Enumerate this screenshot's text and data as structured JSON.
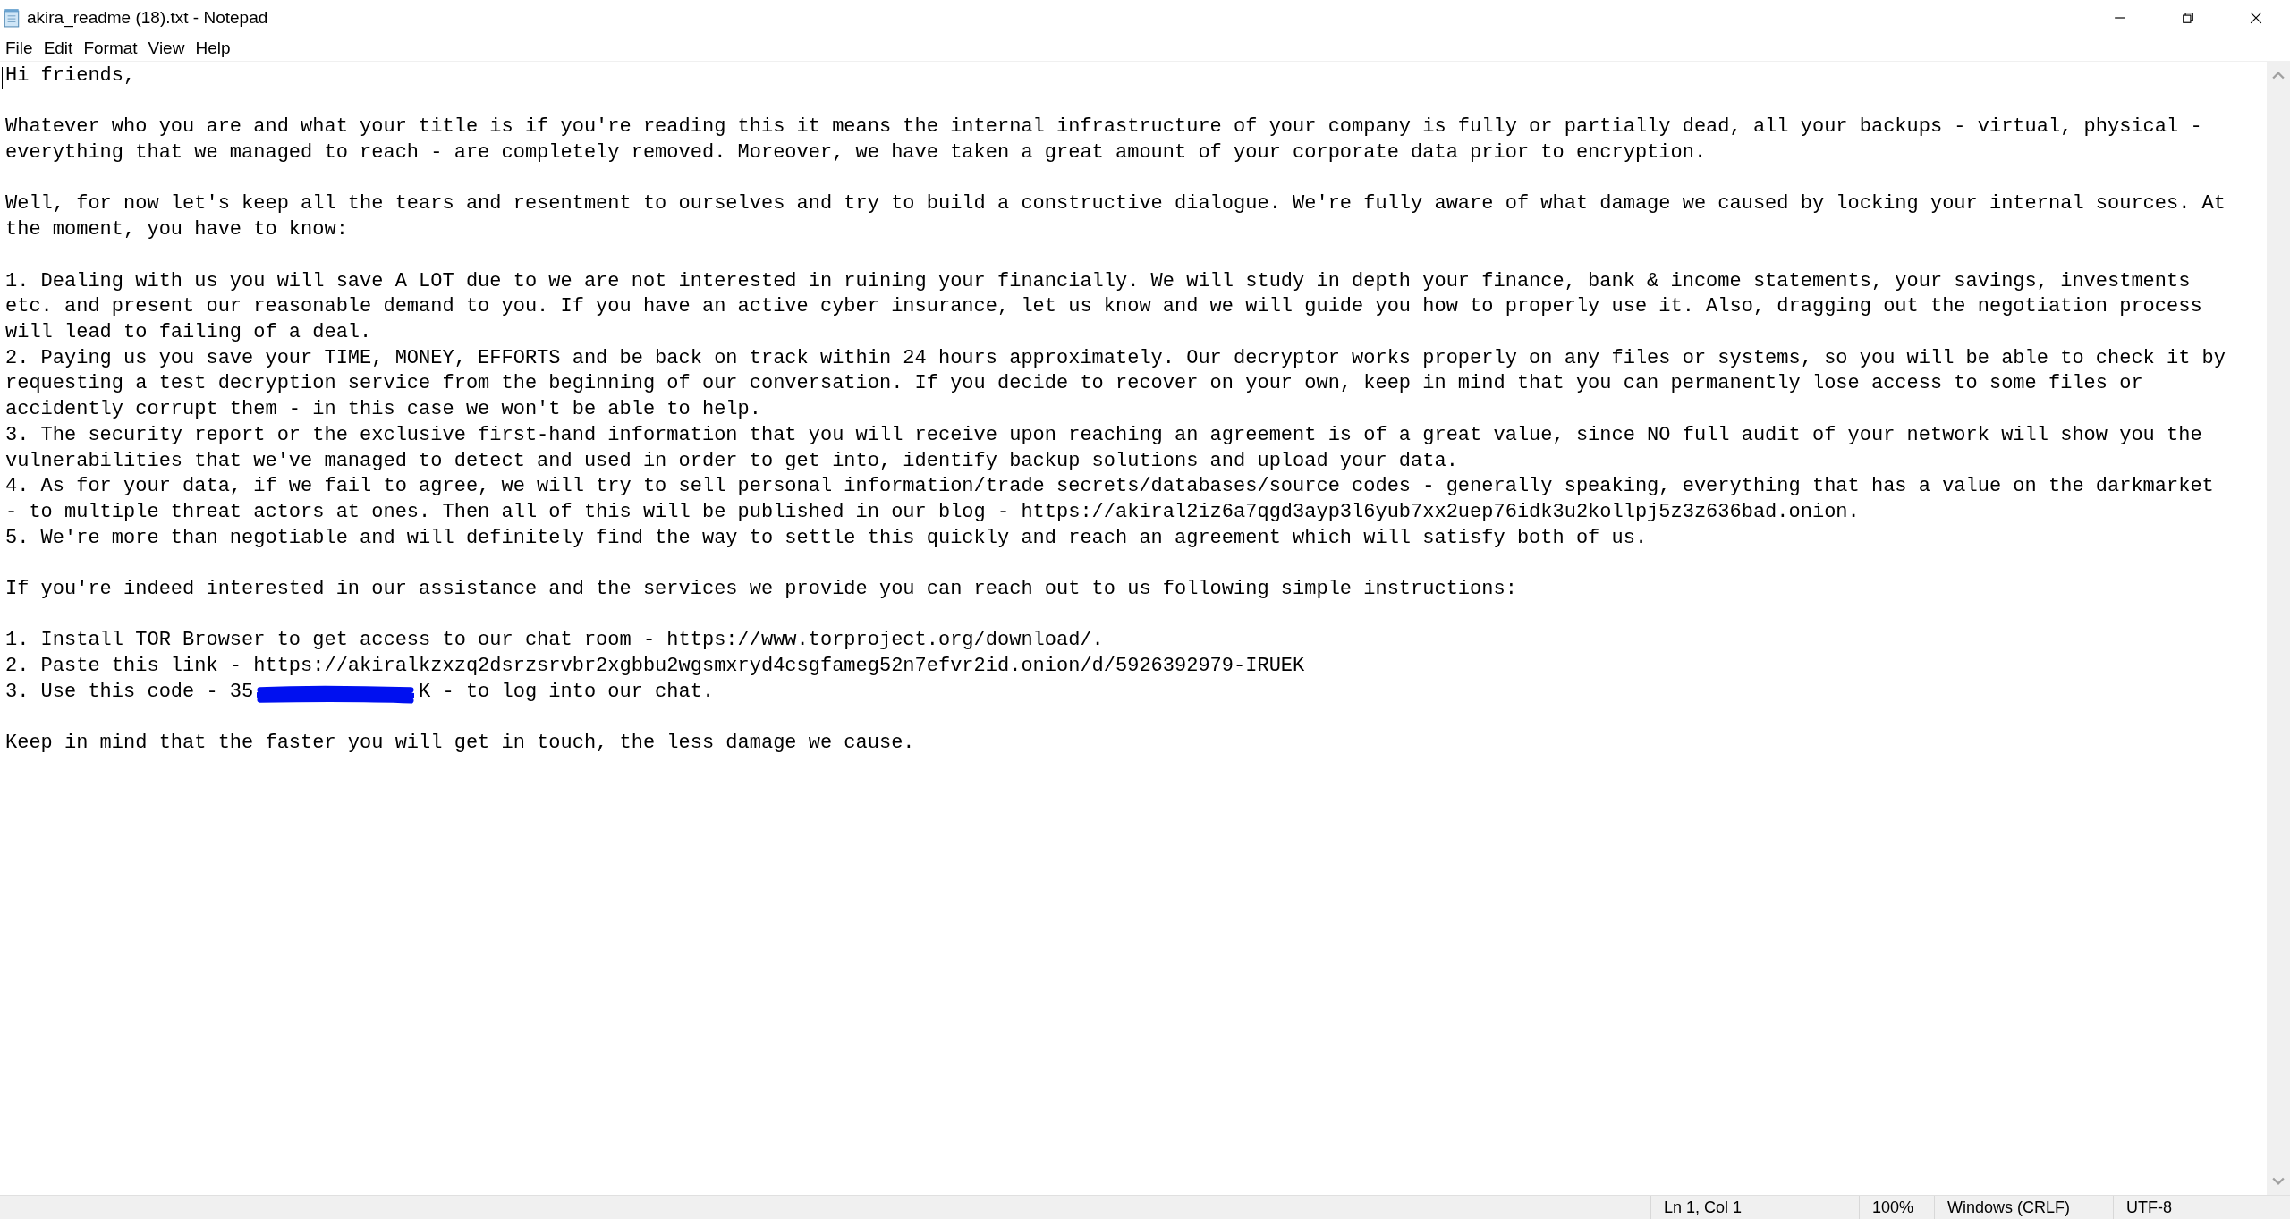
{
  "window": {
    "title": "akira_readme (18).txt - Notepad"
  },
  "menu": [
    "File",
    "Edit",
    "Format",
    "View",
    "Help"
  ],
  "paragraphs": [
    [
      {
        "kind": "text",
        "text": "Hi friends,"
      }
    ],
    [
      {
        "kind": "text",
        "text": "Whatever who you are and what your title is if you're reading this it means the internal infrastructure of your company is fully or partially dead, all your backups - virtual, physical -"
      },
      {
        "kind": "text",
        "text": "everything that we managed to reach - are completely removed. Moreover, we have taken a great amount of your corporate data prior to encryption."
      }
    ],
    [
      {
        "kind": "text",
        "text": "Well, for now let's keep all the tears and resentment to ourselves and try to build a constructive dialogue. We're fully aware of what damage we caused by locking your internal sources. At"
      },
      {
        "kind": "text",
        "text": "the moment, you have to know:"
      }
    ],
    [
      {
        "kind": "text",
        "text": "1. Dealing with us you will save A LOT due to we are not interested in ruining your financially. We will study in depth your finance, bank & income statements, your savings, investments"
      },
      {
        "kind": "text",
        "text": "etc. and present our reasonable demand to you. If you have an active cyber insurance, let us know and we will guide you how to properly use it. Also, dragging out the negotiation process"
      },
      {
        "kind": "text",
        "text": "will lead to failing of a deal."
      },
      {
        "kind": "text",
        "text": "2. Paying us you save your TIME, MONEY, EFFORTS and be back on track within 24 hours approximately. Our decryptor works properly on any files or systems, so you will be able to check it by"
      },
      {
        "kind": "text",
        "text": "requesting a test decryption service from the beginning of our conversation. If you decide to recover on your own, keep in mind that you can permanently lose access to some files or"
      },
      {
        "kind": "text",
        "text": "accidently corrupt them - in this case we won't be able to help."
      },
      {
        "kind": "text",
        "text": "3. The security report or the exclusive first-hand information that you will receive upon reaching an agreement is of a great value, since NO full audit of your network will show you the"
      },
      {
        "kind": "text",
        "text": "vulnerabilities that we've managed to detect and used in order to get into, identify backup solutions and upload your data."
      },
      {
        "kind": "text",
        "text": "4. As for your data, if we fail to agree, we will try to sell personal information/trade secrets/databases/source codes - generally speaking, everything that has a value on the darkmarket"
      },
      {
        "kind": "text",
        "text": "- to multiple threat actors at ones. Then all of this will be published in our blog - https://akiral2iz6a7qgd3ayp3l6yub7xx2uep76idk3u2kollpj5z3z636bad.onion."
      },
      {
        "kind": "text",
        "text": "5. We're more than negotiable and will definitely find the way to settle this quickly and reach an agreement which will satisfy both of us."
      }
    ],
    [
      {
        "kind": "text",
        "text": "If you're indeed interested in our assistance and the services we provide you can reach out to us following simple instructions:"
      }
    ],
    [
      {
        "kind": "text",
        "text": "1. Install TOR Browser to get access to our chat room - https://www.torproject.org/download/."
      },
      {
        "kind": "text",
        "text": "2. Paste this link - https://akiralkzxzq2dsrzsrvbr2xgbbu2wgsmxryd4csgfameg52n7efvr2id.onion/d/5926392979-IRUEK"
      },
      {
        "kind": "redacted",
        "before": "3. Use this code - 35",
        "after": "K - to log into our chat."
      }
    ],
    [
      {
        "kind": "text",
        "text": "Keep in mind that the faster you will get in touch, the less damage we cause."
      }
    ]
  ],
  "status_bar": [
    "Ln 1, Col 1",
    "100%",
    "Windows (CRLF)",
    "UTF-8"
  ]
}
